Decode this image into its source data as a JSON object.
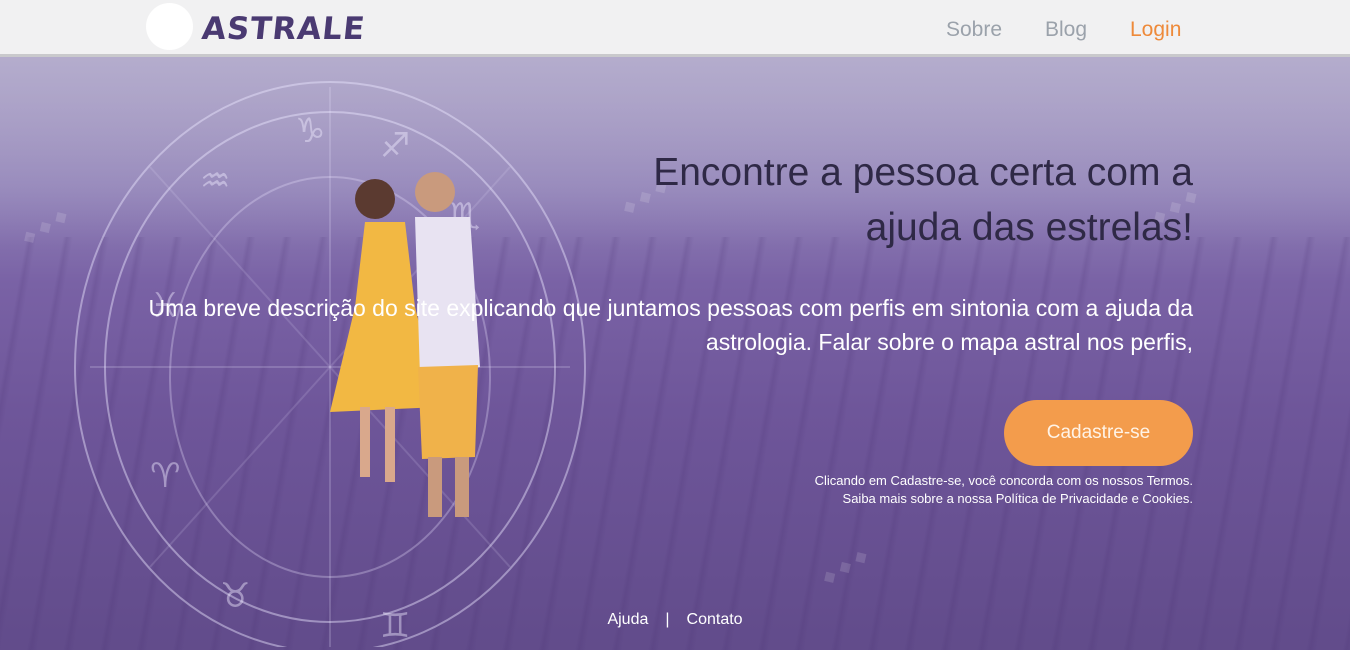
{
  "header": {
    "logo_text": "ASTRALE",
    "nav": {
      "sobre": "Sobre",
      "blog": "Blog",
      "login": "Login"
    }
  },
  "hero": {
    "title": "Encontre a pessoa certa com a ajuda das estrelas!",
    "description": "Uma breve descrição do site explicando que juntamos pessoas com perfis em sintonia com a ajuda da astrologia. Falar sobre o mapa astral nos perfis,",
    "cta_label": "Cadastre-se",
    "terms_line1": "Clicando em Cadastre-se, você concorda com os nossos Termos.",
    "terms_line2": "Saiba mais sobre a nossa Política de Privacidade e Cookies."
  },
  "footer": {
    "help": "Ajuda",
    "separator": "|",
    "contact": "Contato"
  },
  "colors": {
    "accent": "#ee8a3a",
    "cta_background": "#f39c4c",
    "logo": "#4a3a72",
    "hero_overlay": "#7c64aa"
  },
  "images": {
    "hero_background": "lavender-field-with-couple-and-zodiac-wheel"
  }
}
